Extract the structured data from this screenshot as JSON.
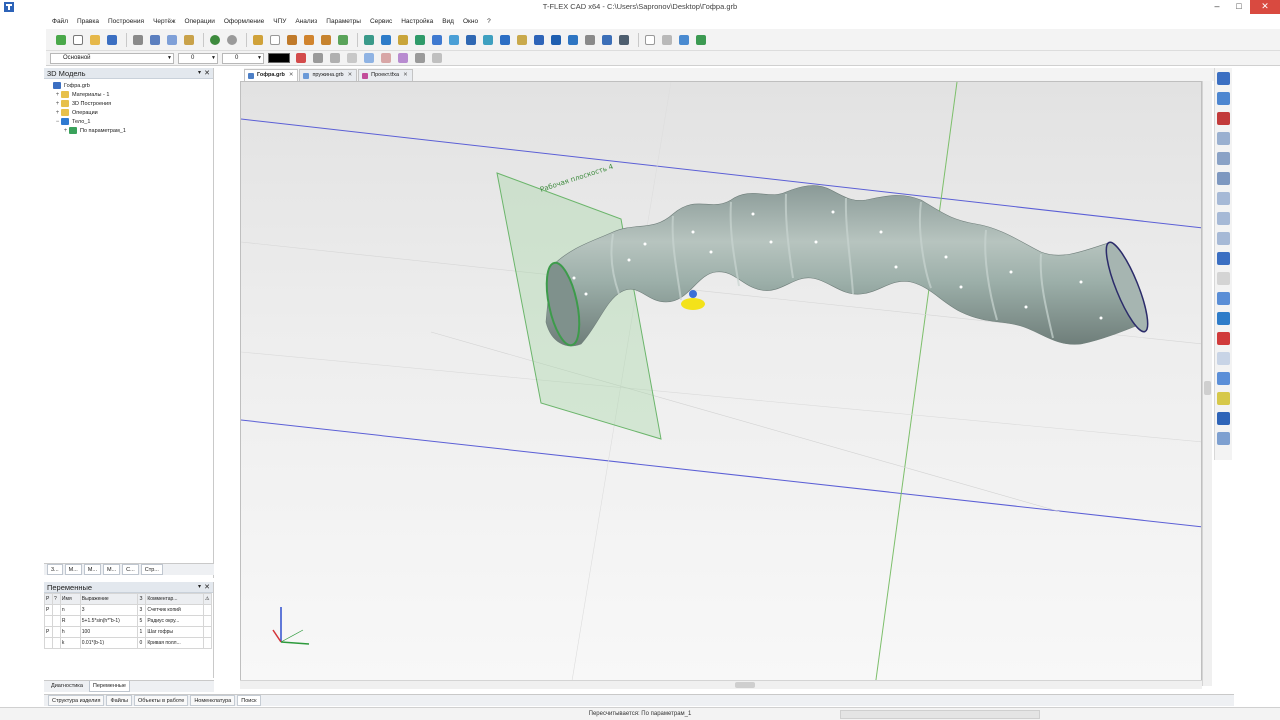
{
  "window": {
    "title": "T-FLEX CAD x64 - C:\\Users\\Sapronov\\Desktop\\Гофра.grb",
    "minimize": "–",
    "maximize": "□",
    "close": "✕"
  },
  "menu": [
    "Файл",
    "Правка",
    "Построения",
    "Чертёж",
    "Операции",
    "Оформление",
    "ЧПУ",
    "Анализ",
    "Параметры",
    "Сервис",
    "Настройка",
    "Вид",
    "Окно",
    "?"
  ],
  "toolbar2": {
    "layer_combo": "Основной",
    "level_value": "0",
    "priority_value": "0"
  },
  "model_panel": {
    "title": "3D Модель",
    "pin": "▾",
    "close": "✕",
    "tree": [
      {
        "label": "Гофра.grb",
        "expander": "",
        "icon_color": "#3b6fc2",
        "indent": 0
      },
      {
        "label": "Материалы - 1",
        "expander": "+",
        "icon_color": "#e7c04a",
        "indent": 1
      },
      {
        "label": "3D Построения",
        "expander": "+",
        "icon_color": "#e7c04a",
        "indent": 1
      },
      {
        "label": "Операции",
        "expander": "+",
        "icon_color": "#e7c04a",
        "indent": 1
      },
      {
        "label": "Тело_1",
        "expander": "−",
        "icon_color": "#2f7bd1",
        "indent": 1
      },
      {
        "label": "По параметрам_1",
        "expander": "+",
        "icon_color": "#3aa25b",
        "indent": 2
      }
    ],
    "tabs": [
      "3...",
      "М...",
      "М...",
      "М...",
      "С...",
      "Стр..."
    ]
  },
  "variables_panel": {
    "title": "Переменные",
    "pin": "▾",
    "close": "✕",
    "columns": [
      "Р",
      "?",
      "Имя",
      "Выражение",
      "З",
      "Комментар...",
      "⚠"
    ],
    "rows": [
      [
        "Р",
        "",
        "n",
        "3",
        "3",
        "Счетчик копий",
        ""
      ],
      [
        "",
        "",
        "R",
        "5+1.5*sin(h*\"b-1)",
        "5",
        "Радиус окру...",
        ""
      ],
      [
        "Р",
        "",
        "h",
        "100",
        "1",
        "Шаг гофры",
        ""
      ],
      [
        "",
        "",
        "k",
        "0.01*(b-1)",
        "0",
        "Кривая полл...",
        ""
      ]
    ]
  },
  "left_bottom_tabs": [
    "Диагностика",
    "Переменные"
  ],
  "doc_tabs": [
    {
      "label": "Гофра.grb",
      "active": true
    },
    {
      "label": "пружина.grb",
      "active": false
    },
    {
      "label": "Проект.tfxa",
      "active": false
    }
  ],
  "doc_tab_close": "✕",
  "viewport": {
    "plane_label": "Рабочая плоскость 4",
    "axis_colors": {
      "x": "#d4353a",
      "y": "#2d9a3c",
      "z": "#2f4fcf"
    }
  },
  "bottom_tabs": [
    "Структура изделия",
    "Файлы",
    "Объекты в работе",
    "Номенклатура",
    "Поиск"
  ],
  "status": {
    "message": "Пересчитывается: По параметрам_1"
  },
  "colors": {
    "accent": "#3b6fc2",
    "surface": "#9fb0ac",
    "plane": "#7ec27e"
  }
}
